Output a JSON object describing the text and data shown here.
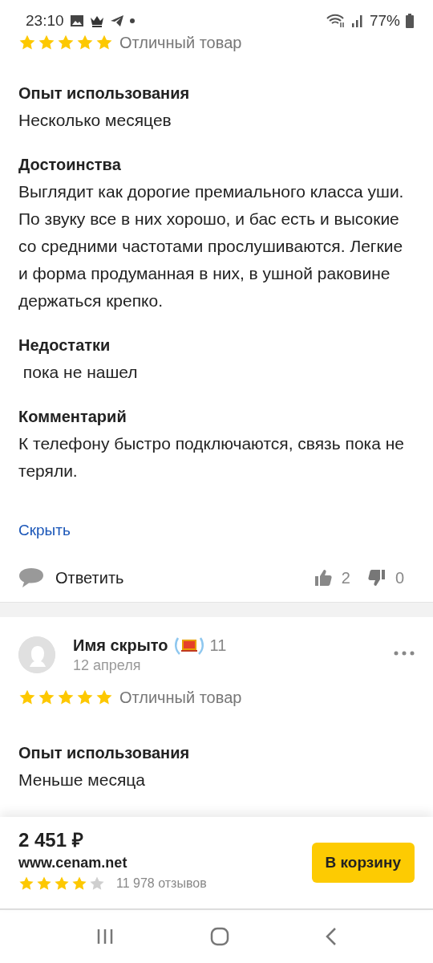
{
  "status_bar": {
    "time": "23:10",
    "battery": "77%"
  },
  "reviews": [
    {
      "stars": 5,
      "title": "Отличный товар",
      "fields": [
        {
          "label": "Опыт использования",
          "text": "Несколько месяцев"
        },
        {
          "label": "Достоинства",
          "text": "Выглядит как дорогие премиального класса уши. По звуку все в них хорошо, и бас есть и высокие со средними частотами прослушиваются. Легкие и форма продуманная в них, в ушной раковине держаться крепко."
        },
        {
          "label": "Недостатки",
          "text": " пока не нашел"
        },
        {
          "label": "Комментарий",
          "text": "К телефону быстро подключаются, связь пока не теряли."
        }
      ],
      "hide_link": "Скрыть",
      "reply": "Ответить",
      "likes": "2",
      "dislikes": "0"
    },
    {
      "author": "Имя скрыто",
      "badge_count": "11",
      "date": "12 апреля",
      "stars": 5,
      "title": "Отличный товар",
      "fields": [
        {
          "label": "Опыт использования",
          "text": "Меньше месяца"
        }
      ]
    }
  ],
  "bottom_bar": {
    "price": "2 451 ₽",
    "seller": "www.cenam.net",
    "stars": 4,
    "reviews_count": "11 978 отзывов",
    "button": "В корзину"
  }
}
